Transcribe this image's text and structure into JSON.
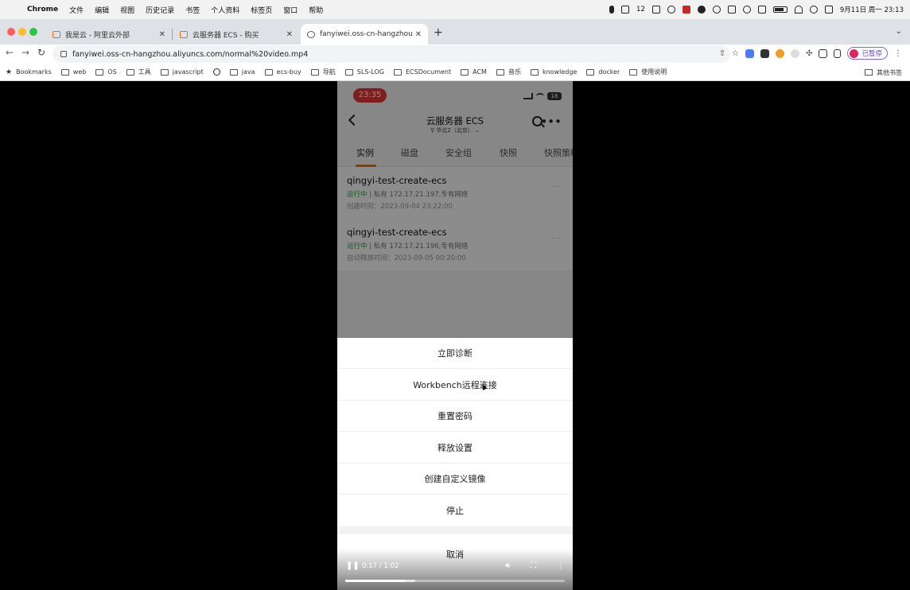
{
  "menubar": {
    "app": "Chrome",
    "items": [
      "文件",
      "编辑",
      "视图",
      "历史记录",
      "书签",
      "个人资料",
      "标签页",
      "窗口",
      "帮助"
    ],
    "battery_label": "12",
    "datetime": "9月11日 周一 23:13"
  },
  "tabs": [
    {
      "label": "我是云 - 阿里云外部",
      "active": false
    },
    {
      "label": "云服务器 ECS - 购买",
      "active": false
    },
    {
      "label": "fanyiwei.oss-cn-hangzhou.aliy…",
      "active": true
    }
  ],
  "toolbar": {
    "url": "fanyiwei.oss-cn-hangzhou.aliyuncs.com/normal%20video.mp4",
    "profile_label": "已暂停"
  },
  "bookmarks": {
    "items": [
      "Bookmarks",
      "web",
      "OS",
      "工具",
      "javascript",
      "",
      "java",
      "ecs-buy",
      "导航",
      "SLS-LOG",
      "ECSDocument",
      "ACM",
      "音乐",
      "knowledge",
      "docker",
      "使用说明"
    ],
    "other": "其他书签"
  },
  "phone": {
    "clock": "23:35",
    "battery": "18",
    "title": "云服务器 ECS",
    "region": "华北2（北京）",
    "tabs": [
      "实例",
      "磁盘",
      "安全组",
      "快照",
      "快照策略"
    ],
    "instances": [
      {
        "name": "qingyi-test-create-ecs",
        "status": "运行中",
        "ip": "| 私有 172.17.21.197,专有网络",
        "time": "创建时间：2023-09-04 23:22:00"
      },
      {
        "name": "qingyi-test-create-ecs",
        "status": "运行中",
        "ip": "| 私有 172.17.21.196,专有网络",
        "time": "自动释放时间：2023-09-05 00:20:00"
      }
    ],
    "actions": [
      "立即诊断",
      "Workbench远程连接",
      "重置密码",
      "释放设置",
      "创建自定义镜像",
      "停止"
    ],
    "cancel": "取消"
  },
  "video": {
    "time": "0:17 / 1:02",
    "progress": 0.27,
    "buffered": 0.32
  }
}
